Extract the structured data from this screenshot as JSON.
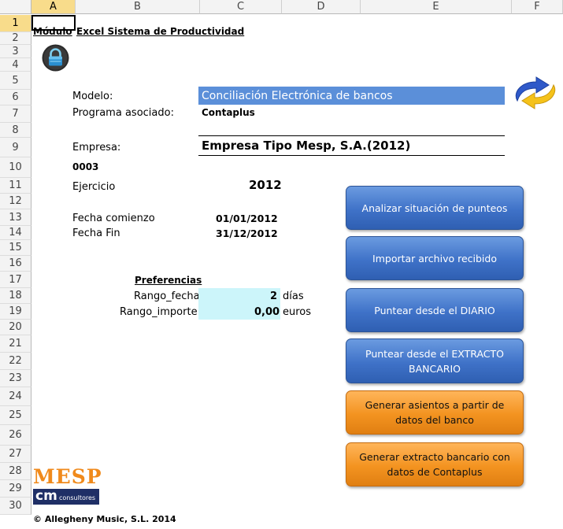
{
  "columns": [
    "A",
    "B",
    "C",
    "D",
    "E",
    "F"
  ],
  "rows": [
    "1",
    "2",
    "3",
    "4",
    "5",
    "6",
    "7",
    "8",
    "9",
    "10",
    "11",
    "12",
    "13",
    "14",
    "15",
    "16",
    "17",
    "18",
    "19",
    "20",
    "21",
    "22",
    "23",
    "24",
    "25",
    "26",
    "27",
    "28",
    "29",
    "30"
  ],
  "title": {
    "part1": "Módulo",
    "part2": "Excel Sistema de Productividad"
  },
  "form": {
    "modelo_label": "Modelo:",
    "modelo_value": "Conciliación Electrónica de bancos",
    "programa_label": "Programa asociado:",
    "programa_value": "Contaplus",
    "empresa_label": "Empresa:",
    "empresa_value": "Empresa Tipo Mesp, S.A.(2012)",
    "empresa_code": "0003",
    "ejercicio_label": "Ejercicio",
    "ejercicio_value": "2012",
    "fecha_comienzo_label": "Fecha comienzo",
    "fecha_comienzo_value": "01/01/2012",
    "fecha_fin_label": "Fecha Fin",
    "fecha_fin_value": "31/12/2012"
  },
  "preferences": {
    "header": "Preferencias",
    "rango_fecha_label": "Rango_fecha",
    "rango_fecha_value": "2",
    "rango_fecha_unit": "días",
    "rango_importe_label": "Rango_importe",
    "rango_importe_value": "0,00",
    "rango_importe_unit": "euros"
  },
  "buttons": {
    "analizar": "Analizar situación de punteos",
    "importar": "Importar archivo recibido",
    "puntear_diario": "Puntear desde el DIARIO",
    "puntear_extracto": "Puntear desde el EXTRACTO BANCARIO",
    "generar_asientos": "Generar asientos a partir de datos del banco",
    "generar_extracto": "Generar extracto bancario  con datos de Contaplus"
  },
  "logo": {
    "top": "MESP",
    "bottom_mark": "cm",
    "bottom_text": "consultores"
  },
  "footer": "© Allegheny Music, S.L. 2014",
  "colors": {
    "modelo_fill": "#5b8fd9",
    "pref_fill": "#ccf5fa",
    "blue_button": "#4a7cd0",
    "orange_button": "#f39320",
    "logo_orange": "#f08a1c",
    "logo_navy": "#1f2f66"
  },
  "icons": {
    "lock": "lock-icon",
    "refresh": "refresh-arrows-icon"
  }
}
